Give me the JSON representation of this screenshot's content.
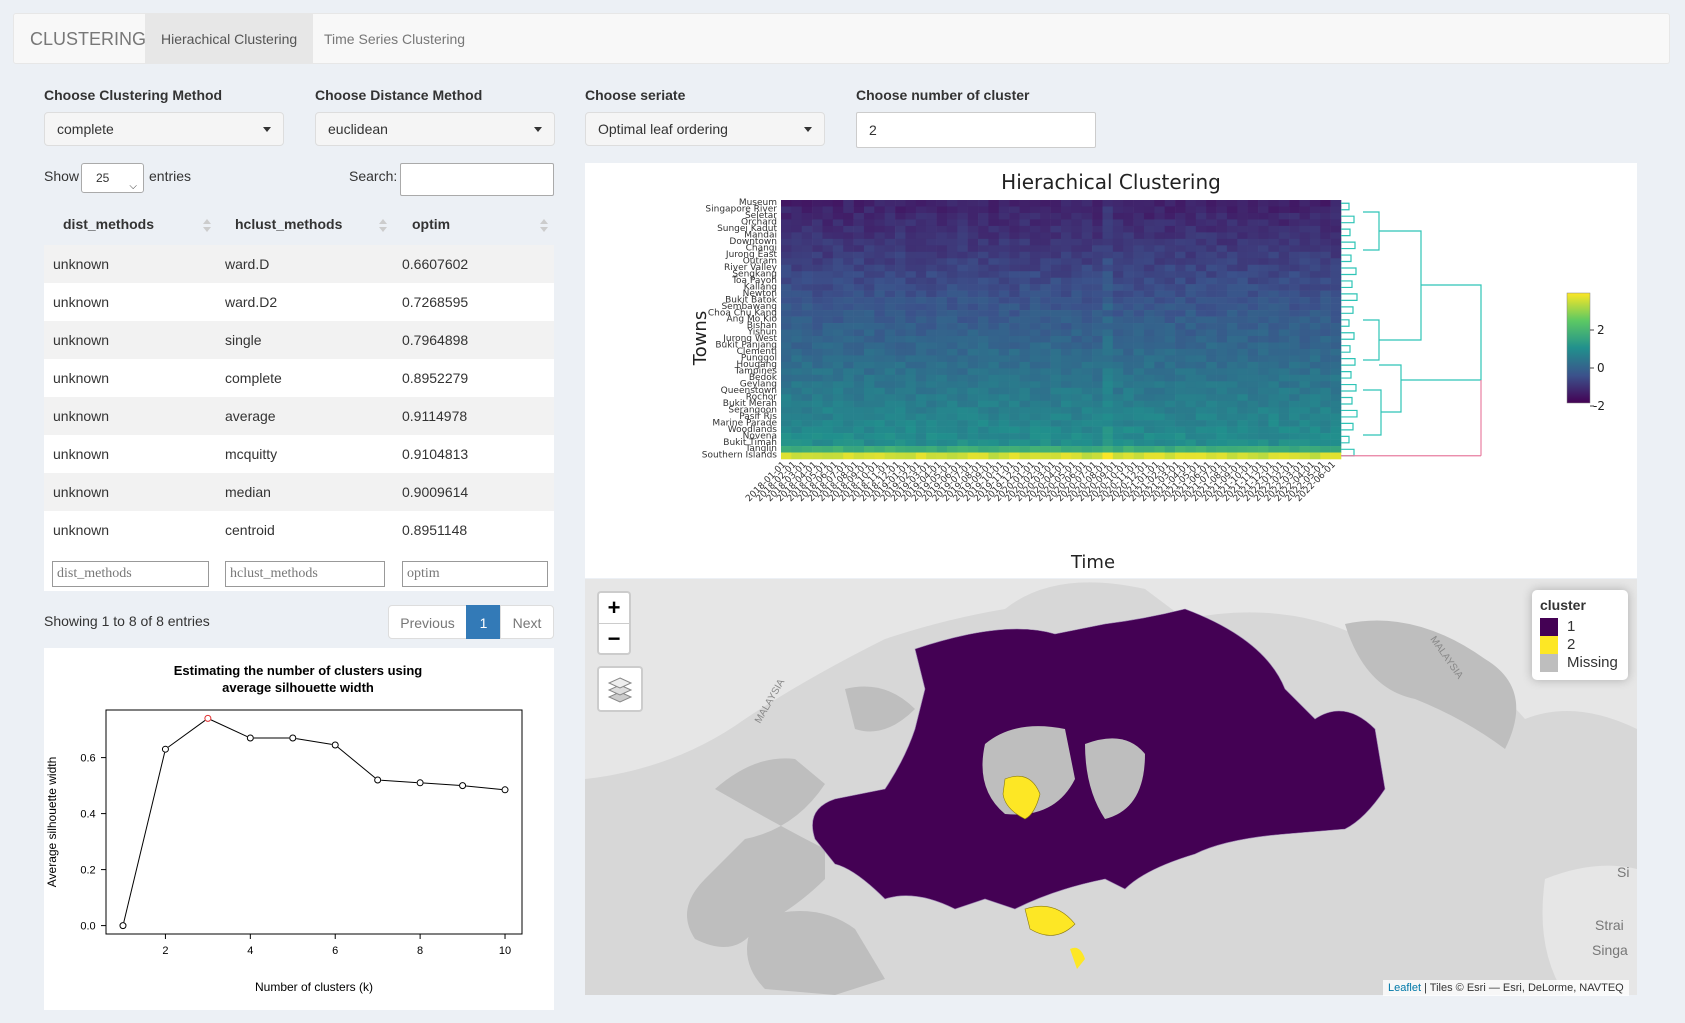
{
  "navbar": {
    "brand": "CLUSTERING",
    "tabs": [
      {
        "label": "Hierachical Clustering",
        "active": true
      },
      {
        "label": "Time Series Clustering",
        "active": false
      }
    ]
  },
  "controls": {
    "clustering_method": {
      "label": "Choose Clustering Method",
      "value": "complete"
    },
    "distance_method": {
      "label": "Choose Distance Method",
      "value": "euclidean"
    },
    "seriate": {
      "label": "Choose seriate",
      "value": "Optimal leaf ordering"
    },
    "num_clusters": {
      "label": "Choose number of cluster",
      "value": "2"
    }
  },
  "datatable": {
    "show_label": "Show",
    "entries_value": "25",
    "entries_label": "entries",
    "search_label": "Search:",
    "columns": [
      "dist_methods",
      "hclust_methods",
      "optim"
    ],
    "rows": [
      [
        "unknown",
        "ward.D",
        "0.6607602"
      ],
      [
        "unknown",
        "ward.D2",
        "0.7268595"
      ],
      [
        "unknown",
        "single",
        "0.7964898"
      ],
      [
        "unknown",
        "complete",
        "0.8952279"
      ],
      [
        "unknown",
        "average",
        "0.9114978"
      ],
      [
        "unknown",
        "mcquitty",
        "0.9104813"
      ],
      [
        "unknown",
        "median",
        "0.9009614"
      ],
      [
        "unknown",
        "centroid",
        "0.8951148"
      ]
    ],
    "filter_placeholders": [
      "dist_methods",
      "hclust_methods",
      "optim"
    ],
    "info": "Showing 1 to 8 of 8 entries",
    "pagination": {
      "previous": "Previous",
      "current": "1",
      "next": "Next"
    }
  },
  "heatmap": {
    "title": "Hierachical Clustering",
    "ylabel": "Towns",
    "xlabel": "Time",
    "towns": [
      "Museum",
      "Singapore River",
      "Seletar",
      "Orchard",
      "Sungei Kadut",
      "Mandai",
      "Downtown",
      "Changi",
      "Jurong East",
      "Outram",
      "River Valley",
      "Sengkang",
      "Toa Payoh",
      "Kallang",
      "Newton",
      "Bukit Batok",
      "Sembawang",
      "Choa Chu Kang",
      "Ang Mo Kio",
      "Bishan",
      "Yishun",
      "Jurong West",
      "Bukit Panjang",
      "Clementi",
      "Punggol",
      "Hougang",
      "Tampines",
      "Bedok",
      "Geylang",
      "Queenstown",
      "Rochor",
      "Bukit Merah",
      "Serangoon",
      "Pasir Ris",
      "Marine Parade",
      "Woodlands",
      "Novena",
      "Bukit Timah",
      "Tanglin",
      "Southern Islands"
    ],
    "time_labels": [
      "2018-01-01",
      "2018-02-01",
      "2018-03-01",
      "2018-04-01",
      "2018-05-01",
      "2018-06-01",
      "2018-07-01",
      "2018-08-01",
      "2018-09-01",
      "2018-10-01",
      "2018-11-01",
      "2018-12-01",
      "2019-01-01",
      "2019-02-01",
      "2019-03-01",
      "2019-04-01",
      "2019-05-01",
      "2019-06-01",
      "2019-07-01",
      "2019-08-01",
      "2019-09-01",
      "2019-10-01",
      "2019-11-01",
      "2019-12-01",
      "2020-01-01",
      "2020-02-01",
      "2020-03-01",
      "2020-04-01",
      "2020-05-01",
      "2020-06-01",
      "2020-07-01",
      "2020-08-01",
      "2020-09-01",
      "2020-10-01",
      "2020-11-01",
      "2020-12-01",
      "2021-01-01",
      "2021-02-01",
      "2021-03-01",
      "2021-04-01",
      "2021-05-01",
      "2021-06-01",
      "2021-07-01",
      "2021-08-01",
      "2021-09-01",
      "2021-10-01",
      "2021-11-01",
      "2021-12-01",
      "2022-01-01",
      "2022-02-01",
      "2022-03-01",
      "2022-04-01",
      "2022-05-01",
      "2022-06-01"
    ],
    "colorbar_ticks": [
      "2",
      "0",
      "-2"
    ],
    "colors": {
      "low": "#440154",
      "mid": "#21908d",
      "high": "#fde725",
      "dendro_main": "#2ec4b6",
      "dendro_alt": "#e87ea1"
    }
  },
  "chart_data": {
    "type": "line",
    "title": "Estimating the number of clusters using average silhouette width",
    "title_lines": [
      "Estimating the number of clusters using",
      "average silhouette width"
    ],
    "xlabel": "Number of clusters (k)",
    "ylabel": "Average silhouette width",
    "x": [
      1,
      2,
      3,
      4,
      5,
      6,
      7,
      8,
      9,
      10
    ],
    "series": [
      {
        "values": [
          0.0,
          0.63,
          0.74,
          0.67,
          0.67,
          0.645,
          0.52,
          0.51,
          0.5,
          0.485
        ]
      }
    ],
    "highlight_x": 3,
    "xticks": [
      2,
      4,
      6,
      8,
      10
    ],
    "yticks": [
      0.0,
      0.2,
      0.4,
      0.6
    ],
    "xlim": [
      0.6,
      10.4
    ],
    "ylim": [
      -0.03,
      0.77
    ],
    "ytick_labels": [
      "0.0",
      "0.2",
      "0.4",
      "0.6"
    ]
  },
  "map": {
    "zoom_in": "+",
    "zoom_out": "−",
    "legend_title": "cluster",
    "legend_items": [
      {
        "label": "1",
        "color": "#440154"
      },
      {
        "label": "2",
        "color": "#fde725"
      },
      {
        "label": "Missing",
        "color": "#bebebe"
      }
    ],
    "place_labels": [
      "MALAYSIA",
      "MALAYSIA",
      "Si",
      "Strai",
      "Singa"
    ],
    "attribution_link": "Leaflet",
    "attribution_text": " | Tiles © Esri — Esri, DeLorme, NAVTEQ"
  }
}
